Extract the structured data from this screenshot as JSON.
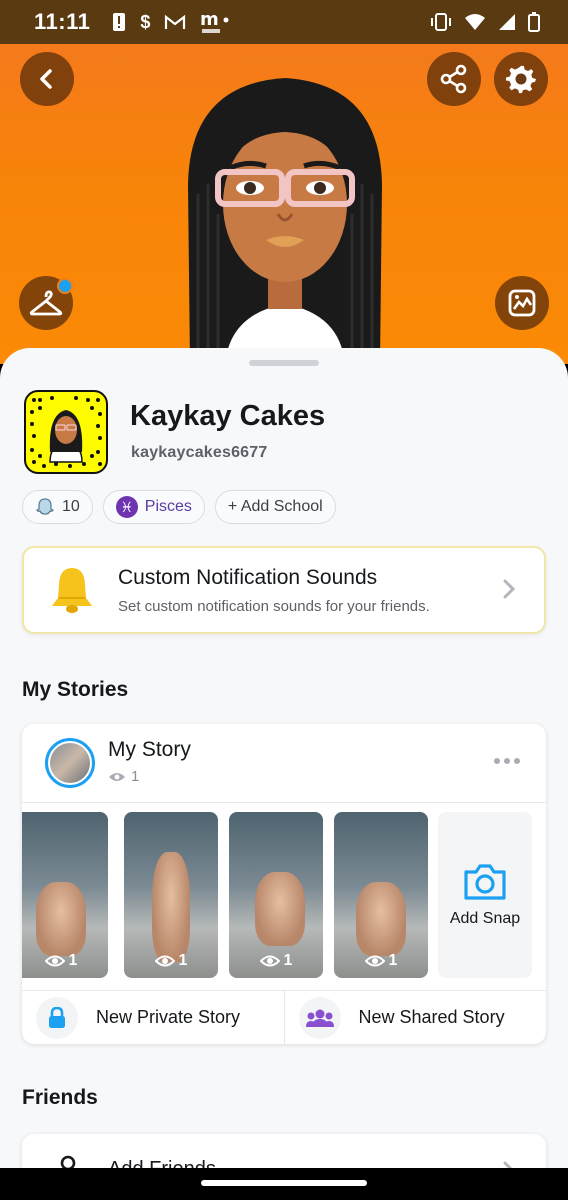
{
  "status_bar": {
    "time": "11:11",
    "left_icons": [
      "alert-icon",
      "dollar-icon",
      "gmail-icon",
      "mzone-icon"
    ],
    "right_icons": [
      "vibrate-icon",
      "wifi-icon",
      "signal-icon",
      "battery-icon"
    ]
  },
  "profile": {
    "display_name": "Kaykay Cakes",
    "username": "kaykaycakes6677",
    "chips": [
      {
        "icon": "snapscore-icon",
        "label": "10"
      },
      {
        "icon": "pisces-icon",
        "label": "Pisces"
      },
      {
        "icon": "add-icon",
        "label": "+ Add School"
      }
    ]
  },
  "notification_card": {
    "title": "Custom Notification Sounds",
    "subtitle": "Set custom notification sounds for your friends."
  },
  "my_stories": {
    "section_title": "My Stories",
    "story_name": "My Story",
    "story_views": "1",
    "snaps": [
      {
        "views": "1"
      },
      {
        "views": "1"
      },
      {
        "views": "1"
      },
      {
        "views": "1"
      }
    ],
    "add_snap_label": "Add Snap",
    "new_private_story": "New Private Story",
    "new_shared_story": "New Shared Story"
  },
  "friends": {
    "section_title": "Friends",
    "add_friends_label": "Add Friends"
  },
  "colors": {
    "header_orange": "#f8830a",
    "snapcode_yellow": "#fffc00",
    "accent_blue": "#1ca0f2",
    "pisces_purple": "#6f35b0"
  }
}
